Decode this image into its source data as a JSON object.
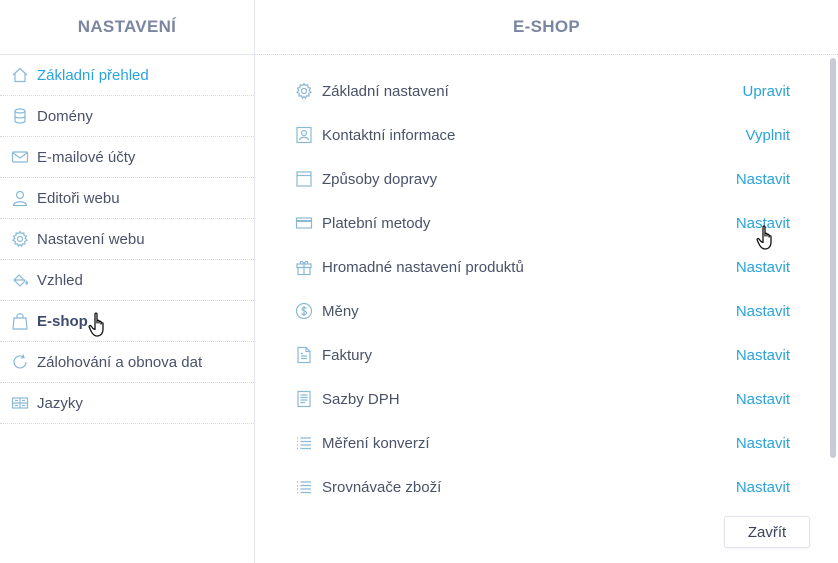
{
  "colors": {
    "accent": "#2aa3dc",
    "header": "#7b86a2",
    "text": "#4a5268"
  },
  "sidebar": {
    "title": "NASTAVENÍ",
    "items": [
      {
        "label": "Základní přehled",
        "icon": "home-icon"
      },
      {
        "label": "Domény",
        "icon": "database-icon"
      },
      {
        "label": "E-mailové účty",
        "icon": "envelope-icon"
      },
      {
        "label": "Editoři webu",
        "icon": "user-icon"
      },
      {
        "label": "Nastavení webu",
        "icon": "gear-icon"
      },
      {
        "label": "Vzhled",
        "icon": "paint-bucket-icon"
      },
      {
        "label": "E-shop",
        "icon": "shopping-bag-icon"
      },
      {
        "label": "Zálohování a obnova dat",
        "icon": "refresh-icon"
      },
      {
        "label": "Jazyky",
        "icon": "language-flag-icon"
      }
    ]
  },
  "main": {
    "title": "E-SHOP",
    "rows": [
      {
        "label": "Základní nastavení",
        "action": "Upravit",
        "icon": "gear-icon"
      },
      {
        "label": "Kontaktní informace",
        "action": "Vyplnit",
        "icon": "contact-card-icon"
      },
      {
        "label": "Způsoby dopravy",
        "action": "Nastavit",
        "icon": "box-icon"
      },
      {
        "label": "Platební metody",
        "action": "Nastavit",
        "icon": "credit-card-icon"
      },
      {
        "label": "Hromadné nastavení produktů",
        "action": "Nastavit",
        "icon": "gift-icon"
      },
      {
        "label": "Měny",
        "action": "Nastavit",
        "icon": "currency-icon"
      },
      {
        "label": "Faktury",
        "action": "Nastavit",
        "icon": "invoice-icon"
      },
      {
        "label": "Sazby DPH",
        "action": "Nastavit",
        "icon": "tax-document-icon"
      },
      {
        "label": "Měření konverzí",
        "action": "Nastavit",
        "icon": "list-icon"
      },
      {
        "label": "Srovnávače zboží",
        "action": "Nastavit",
        "icon": "list-icon"
      }
    ],
    "close_label": "Zavřít"
  }
}
